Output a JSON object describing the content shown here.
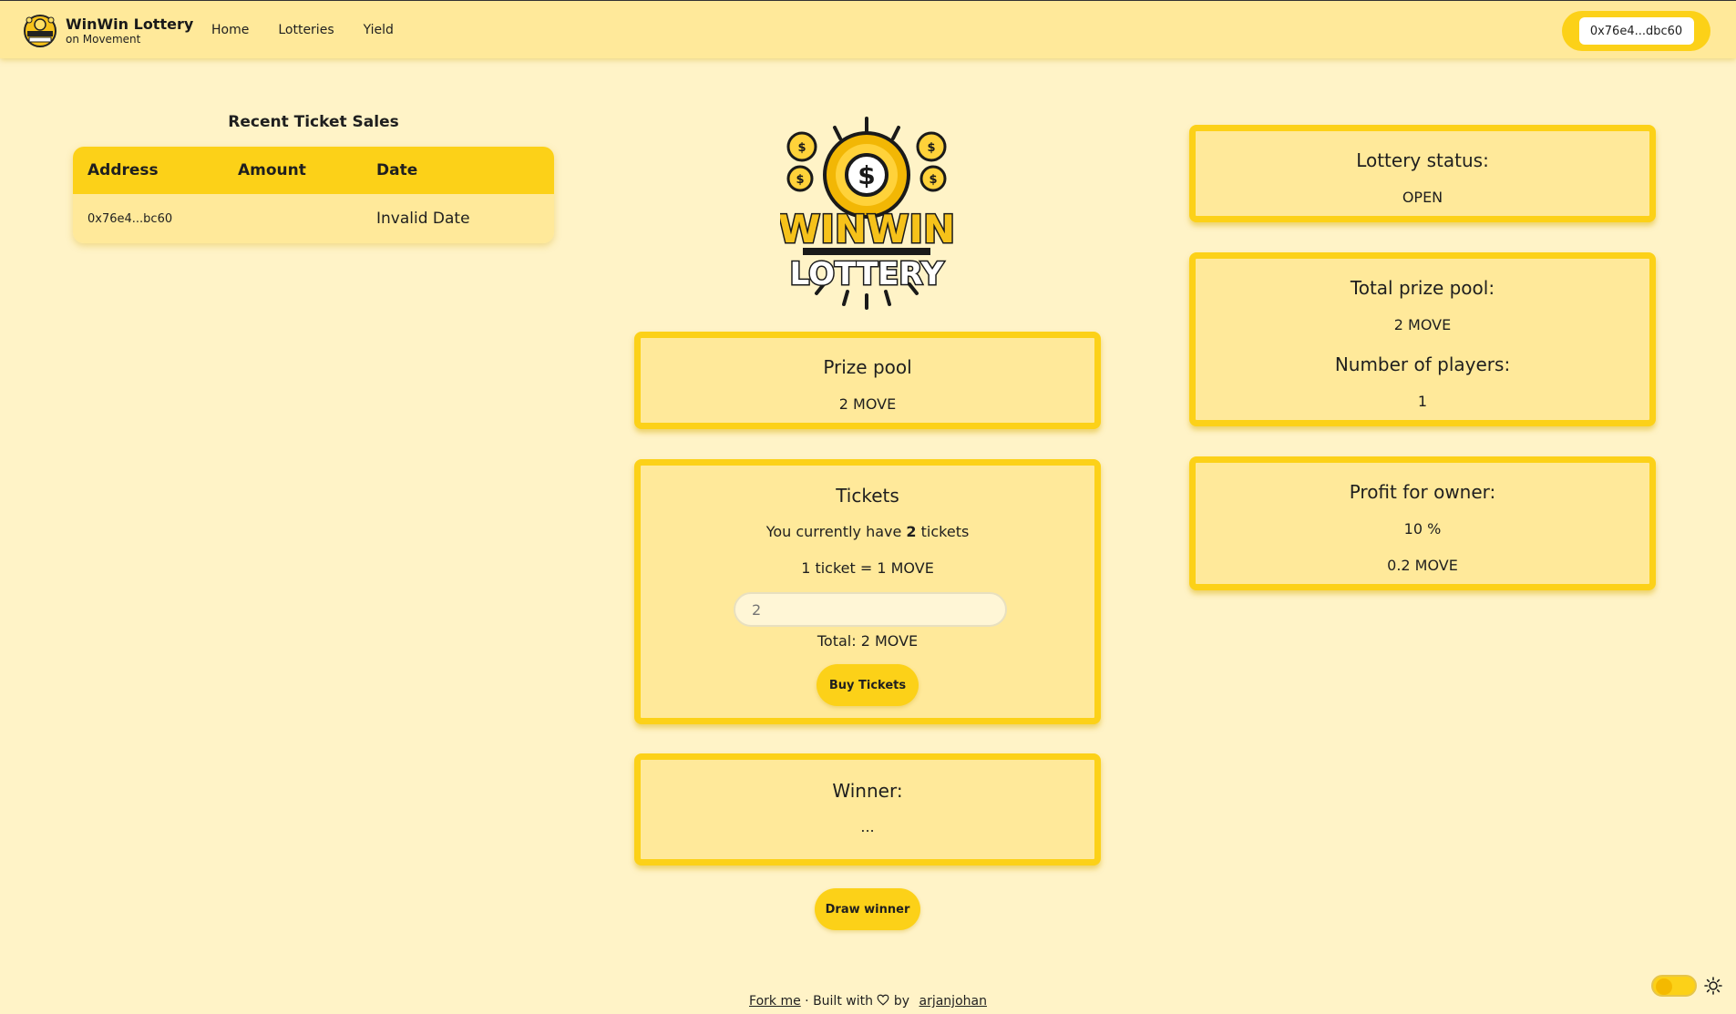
{
  "brand": {
    "title": "WinWin Lottery",
    "subtitle": "on Movement"
  },
  "nav": {
    "items": [
      "Home",
      "Lotteries",
      "Yield"
    ]
  },
  "wallet": {
    "address": "0x76e4...dbc60"
  },
  "sales": {
    "title": "Recent Ticket Sales",
    "columns": [
      "Address",
      "Amount",
      "Date"
    ],
    "rows": [
      {
        "address": "0x76e4...bc60",
        "amount": "",
        "date": "Invalid Date"
      }
    ]
  },
  "center_logo": {
    "line1": "WINWIN",
    "line2": "LOTTERY"
  },
  "prize_pool": {
    "title": "Prize pool",
    "value": "2 MOVE"
  },
  "tickets": {
    "title": "Tickets",
    "have_prefix": "You currently have ",
    "have_count": "2",
    "have_suffix": " tickets",
    "rate": "1 ticket = 1 MOVE",
    "input_placeholder": "2",
    "total": "Total: 2 MOVE",
    "buy_label": "Buy Tickets"
  },
  "winner": {
    "title": "Winner:",
    "value": "..."
  },
  "draw_label": "Draw winner",
  "status": {
    "title": "Lottery status:",
    "value": "OPEN"
  },
  "pool": {
    "title": "Total prize pool:",
    "value": "2 MOVE",
    "players_title": "Number of players:",
    "players_value": "1"
  },
  "profit": {
    "title": "Profit for owner:",
    "percent": "10 %",
    "amount": "0.2 MOVE"
  },
  "footer": {
    "fork": "Fork me",
    "sep": " · ",
    "built": "Built with",
    "by": "by",
    "author": "arjanjohan"
  },
  "colors": {
    "accent": "#fcd118",
    "background": "#fff3c7",
    "panel": "#ffe99a"
  }
}
